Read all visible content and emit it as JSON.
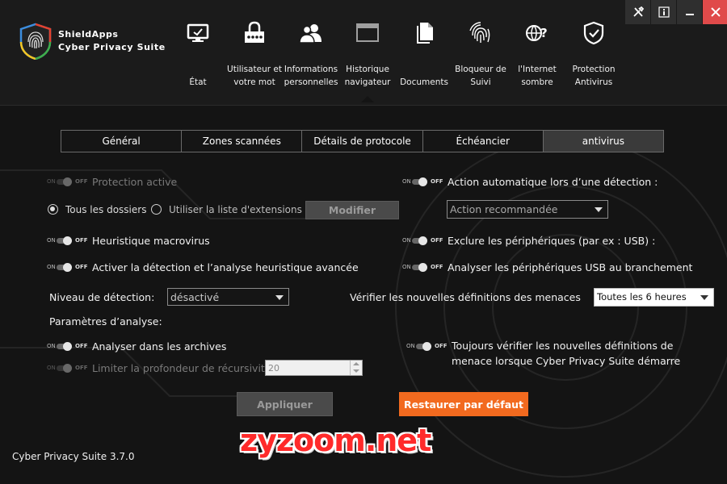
{
  "brand": {
    "top": "ShieldApps",
    "bottom": "Cyber Privacy Suite"
  },
  "window_buttons": [
    "tools-icon",
    "info-icon",
    "minimize-icon",
    "close-icon"
  ],
  "nav": [
    {
      "icon": "monitor-icon",
      "label": "État"
    },
    {
      "icon": "user-password-icon",
      "label": "Utilisateur et votre mot"
    },
    {
      "icon": "users-icon",
      "label": "Informations personnelles"
    },
    {
      "icon": "browser-window-icon",
      "label": "Historique navigateur"
    },
    {
      "icon": "documents-icon",
      "label": "Documents"
    },
    {
      "icon": "fingerprint-icon",
      "label": "Bloqueur de Suivi"
    },
    {
      "icon": "globe-question-icon",
      "label": "l'Internet sombre"
    },
    {
      "icon": "shield-check-icon",
      "label": "Protection Antivirus"
    }
  ],
  "tabs": [
    "Général",
    "Zones scannées",
    "Détails de protocole",
    "Échéancier",
    "antivirus"
  ],
  "toggle_on": "ON",
  "toggle_off": "OFF",
  "settings": {
    "protection_active": "Protection active",
    "all_folders": "Tous les dossiers",
    "use_extensions": "Utiliser la liste d'extensions",
    "modify_button": "Modifier",
    "heuristic_macro": "Heuristique macrovirus",
    "advanced_heuristic": "Activer la détection et l’analyse heuristique avancée",
    "detection_level_label": "Niveau de détection:",
    "detection_level_value": "désactivé",
    "scan_params_label": "Paramètres d’analyse:",
    "scan_archives": "Analyser dans les archives",
    "limit_recursion": "Limiter la profondeur de récursivité",
    "recursion_value": "20",
    "auto_action_label": "Action automatique lors d’une détection :",
    "auto_action_value": "Action recommandée",
    "exclude_devices": "Exclure les périphériques (par ex : USB) :",
    "scan_usb": "Analyser les périphériques USB au branchement",
    "check_defs_label": "Vérifier les nouvelles définitions des menaces",
    "check_defs_value": "Toutes les 6 heures",
    "always_check_line1": "Toujours vérifier les nouvelles définitions de",
    "always_check_line2": "menace lorsque Cyber Privacy Suite démarre"
  },
  "buttons": {
    "apply": "Appliquer",
    "restore": "Restaurer par défaut"
  },
  "watermark": "zyzoom.net",
  "version": "Cyber Privacy Suite 3.7.0",
  "colors": {
    "accent": "#f26a1f",
    "close": "#e04a4a"
  }
}
